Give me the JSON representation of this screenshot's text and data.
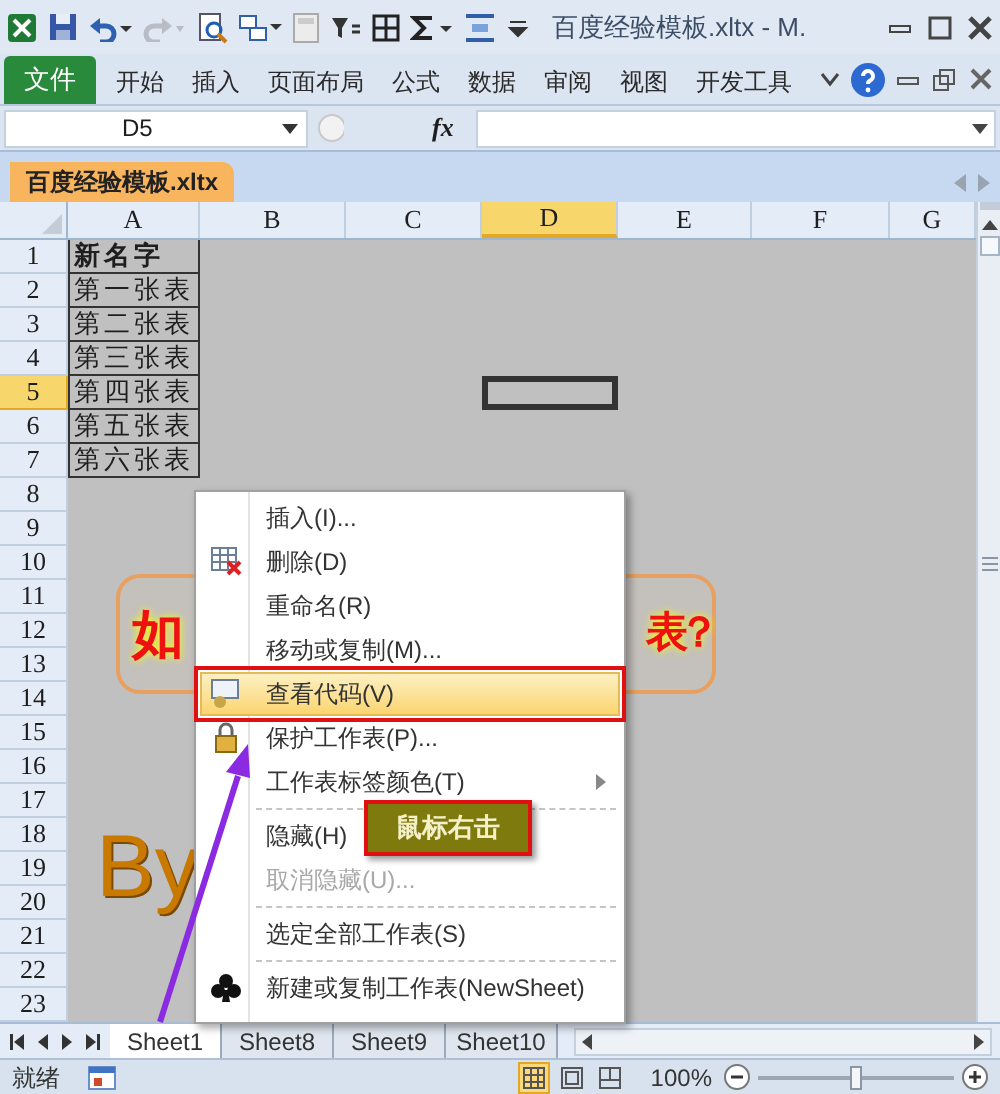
{
  "window": {
    "title": "百度经验模板.xltx - M."
  },
  "ribbon_tabs": [
    {
      "label": "文件",
      "kind": "file"
    },
    {
      "label": "开始",
      "kind": "tab"
    },
    {
      "label": "插入",
      "kind": "tab"
    },
    {
      "label": "页面布局",
      "kind": "tab"
    },
    {
      "label": "公式",
      "kind": "tab"
    },
    {
      "label": "数据",
      "kind": "tab"
    },
    {
      "label": "审阅",
      "kind": "tab"
    },
    {
      "label": "视图",
      "kind": "tab"
    },
    {
      "label": "开发工具",
      "kind": "tab"
    }
  ],
  "formula_bar": {
    "name_box": "D5",
    "function_label": "fx"
  },
  "workbook_tab": {
    "label": "百度经验模板.xltx"
  },
  "columns": [
    {
      "label": "A",
      "selected": false
    },
    {
      "label": "B",
      "selected": false
    },
    {
      "label": "C",
      "selected": false
    },
    {
      "label": "D",
      "selected": true
    },
    {
      "label": "E",
      "selected": false
    },
    {
      "label": "F",
      "selected": false
    },
    {
      "label": "G",
      "selected": false
    }
  ],
  "rows": [
    {
      "label": "1",
      "selected": false,
      "cells": [
        {
          "text": "新名字",
          "bold": true
        }
      ]
    },
    {
      "label": "2",
      "selected": false,
      "cells": [
        {
          "text": "第一张表",
          "bold": false
        }
      ]
    },
    {
      "label": "3",
      "selected": false,
      "cells": [
        {
          "text": "第二张表",
          "bold": false
        }
      ]
    },
    {
      "label": "4",
      "selected": false,
      "cells": [
        {
          "text": "第三张表",
          "bold": false
        }
      ]
    },
    {
      "label": "5",
      "selected": true,
      "cells": [
        {
          "text": "第四张表",
          "bold": false
        }
      ]
    },
    {
      "label": "6",
      "selected": false,
      "cells": [
        {
          "text": "第五张表",
          "bold": false
        }
      ]
    },
    {
      "label": "7",
      "selected": false,
      "cells": [
        {
          "text": "第六张表",
          "bold": false
        }
      ]
    },
    {
      "label": "8",
      "selected": false
    },
    {
      "label": "9",
      "selected": false
    },
    {
      "label": "10",
      "selected": false
    },
    {
      "label": "11",
      "selected": false
    },
    {
      "label": "12",
      "selected": false
    },
    {
      "label": "13",
      "selected": false
    },
    {
      "label": "14",
      "selected": false
    },
    {
      "label": "15",
      "selected": false
    },
    {
      "label": "16",
      "selected": false
    },
    {
      "label": "17",
      "selected": false
    },
    {
      "label": "18",
      "selected": false
    },
    {
      "label": "19",
      "selected": false
    },
    {
      "label": "20",
      "selected": false
    },
    {
      "label": "21",
      "selected": false
    },
    {
      "label": "22",
      "selected": false
    },
    {
      "label": "23",
      "selected": false
    }
  ],
  "shapes": [
    {
      "kind": "rounded-label",
      "texts": [
        "如",
        "表？"
      ]
    },
    {
      "kind": "wordart",
      "texts": [
        "By"
      ]
    }
  ],
  "context_menu": {
    "items": [
      {
        "label": "插入(I)...",
        "kind": "plain",
        "selected": false,
        "disabled": false
      },
      {
        "label": "删除(D)",
        "kind": "table",
        "selected": false,
        "disabled": false
      },
      {
        "label": "重命名(R)",
        "kind": "plain",
        "selected": false,
        "disabled": false
      },
      {
        "label": "移动或复制(M)...",
        "kind": "plain",
        "selected": false,
        "disabled": false
      },
      {
        "label": "查看代码(V)",
        "kind": "code",
        "selected": true,
        "disabled": false
      },
      {
        "label": "保护工作表(P)...",
        "kind": "lock",
        "selected": false,
        "disabled": false
      },
      {
        "label": "工作表标签颜色(T)",
        "kind": "submenu",
        "selected": false,
        "disabled": false
      },
      {
        "kind": "separator"
      },
      {
        "label": "隐藏(H)",
        "kind": "plain",
        "selected": false,
        "disabled": false
      },
      {
        "label": "取消隐藏(U)...",
        "kind": "plain",
        "selected": false,
        "disabled": true
      },
      {
        "kind": "separator"
      },
      {
        "label": "选定全部工作表(S)",
        "kind": "plain",
        "selected": false,
        "disabled": false
      },
      {
        "kind": "separator"
      },
      {
        "label": "新建或复制工作表(NewSheet)",
        "kind": "club",
        "selected": false,
        "disabled": false
      }
    ]
  },
  "callout": {
    "text": "鼠标右击"
  },
  "sheet_tabs": [
    {
      "label": "Sheet1",
      "selected": true
    },
    {
      "label": "Sheet8",
      "selected": false
    },
    {
      "label": "Sheet9",
      "selected": false
    },
    {
      "label": "Sheet10",
      "selected": false
    }
  ],
  "status_bar": {
    "text": "就绪",
    "views": [
      {
        "selected": true
      },
      {
        "selected": false
      },
      {
        "selected": false
      }
    ],
    "zoom": "100%",
    "zoom_slider": {
      "level": 0.5
    }
  }
}
